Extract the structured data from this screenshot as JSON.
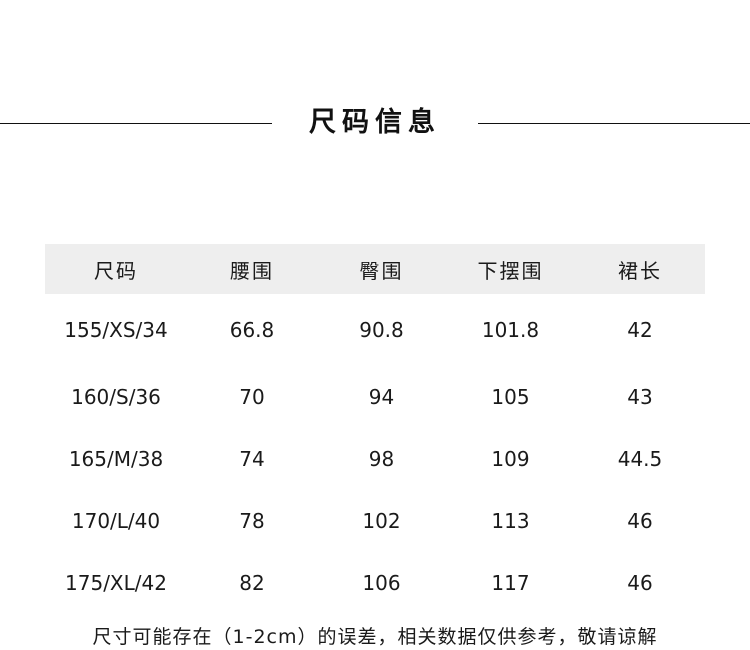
{
  "title": "尺码信息",
  "table": {
    "headers": [
      "尺码",
      "腰围",
      "臀围",
      "下摆围",
      "裙长"
    ],
    "rows": [
      [
        "155/XS/34",
        "66.8",
        "90.8",
        "101.8",
        "42"
      ],
      [
        "160/S/36",
        "70",
        "94",
        "105",
        "43"
      ],
      [
        "165/M/38",
        "74",
        "98",
        "109",
        "44.5"
      ],
      [
        "170/L/40",
        "78",
        "102",
        "113",
        "46"
      ],
      [
        "175/XL/42",
        "82",
        "106",
        "117",
        "46"
      ]
    ]
  },
  "note": "尺寸可能存在（1-2cm）的误差，相关数据仅供参考，敬请谅解",
  "colors": {
    "header_bg": "#eeeeee",
    "text": "#1a1a1a",
    "rule": "#111111"
  }
}
